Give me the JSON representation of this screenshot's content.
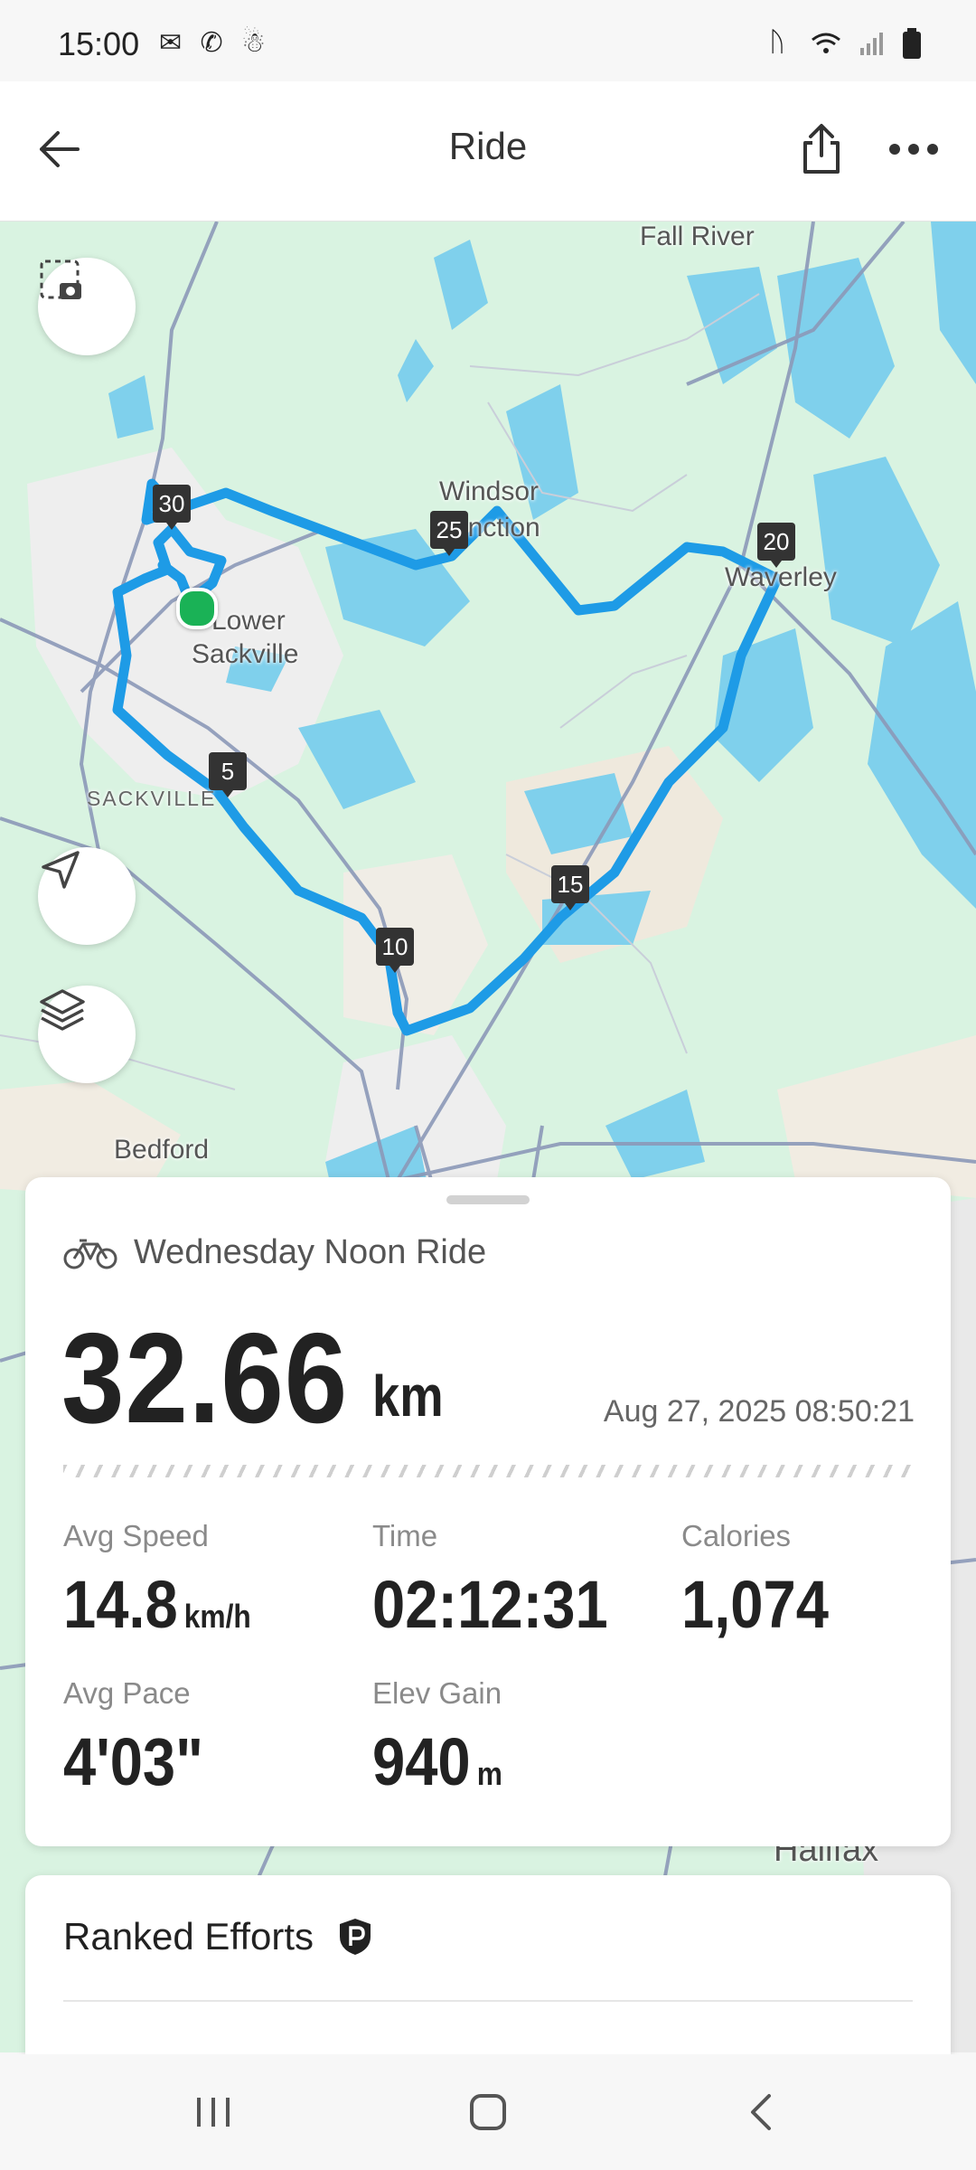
{
  "status_bar": {
    "time": "15:00",
    "left_icons": [
      "mail-icon",
      "phone-icon",
      "notification-icon"
    ],
    "right_icons": [
      "bluetooth-icon",
      "wifi-icon",
      "signal-icon",
      "battery-icon"
    ]
  },
  "header": {
    "title": "Ride",
    "back_icon": "arrow-left-icon",
    "share_icon": "share-icon",
    "more_icon": "more-horizontal-icon"
  },
  "map": {
    "places": {
      "fall_river": "Fall River",
      "windsor_line1": "Windsor",
      "windsor_line2": "Junction",
      "waverley": "Waverley",
      "lower_sackville_line1": "Lower",
      "lower_sackville_line2": "Sackville",
      "sackville": "SACKVILLE",
      "bedford": "Bedford",
      "halifax": "Halifax"
    },
    "km_markers": [
      "5",
      "10",
      "15",
      "20",
      "25",
      "30"
    ],
    "buttons": [
      "screenshot-icon",
      "navigation-icon",
      "layers-icon"
    ],
    "route_color": "#1e9be6"
  },
  "activity": {
    "icon": "bicycle-icon",
    "name": "Wednesday Noon Ride",
    "distance": "32.66",
    "distance_unit": "km",
    "datetime": "Aug 27, 2025 08:50:21"
  },
  "stats": {
    "avg_speed": {
      "label": "Avg Speed",
      "value": "14.8",
      "unit": "km/h"
    },
    "time": {
      "label": "Time",
      "value": "02:12:31"
    },
    "calories": {
      "label": "Calories",
      "value": "1,074"
    },
    "avg_pace": {
      "label": "Avg Pace",
      "value": "4'03\""
    },
    "elev_gain": {
      "label": "Elev Gain",
      "value": "940",
      "unit": "m"
    }
  },
  "ranked_efforts": {
    "title": "Ranked Efforts",
    "badge_icon": "shield-p-icon"
  },
  "nav_bar": [
    "recents-icon",
    "home-icon",
    "back-icon"
  ]
}
